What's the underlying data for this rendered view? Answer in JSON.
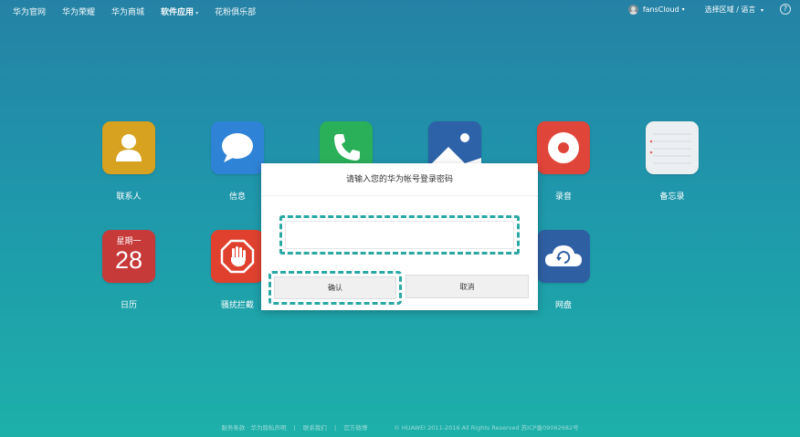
{
  "nav": {
    "items": [
      {
        "label": "华为官网"
      },
      {
        "label": "华为荣耀"
      },
      {
        "label": "华为商城"
      },
      {
        "label": "软件应用"
      },
      {
        "label": "花粉俱乐部"
      }
    ],
    "user": "fansCloud",
    "region": "选择区域 / 语言",
    "help": "?"
  },
  "apps": [
    {
      "label": "联系人",
      "color": "#d6a21f",
      "icon": "contact-icon"
    },
    {
      "label": "信息",
      "color": "#2f83d6",
      "icon": "message-icon"
    },
    {
      "label": "",
      "color": "#2bb05a",
      "icon": "phone-icon"
    },
    {
      "label": "",
      "color": "#2d62a8",
      "icon": "gallery-icon"
    },
    {
      "label": "录音",
      "color": "#e0453a",
      "icon": "record-icon"
    },
    {
      "label": "备忘录",
      "color": "#eceff2",
      "icon": "notepad-icon"
    },
    {
      "label": "日历",
      "color": "#c63a3a",
      "icon": "calendar-icon",
      "weekday": "星期一",
      "day": "28"
    },
    {
      "label": "骚扰拦截",
      "color": "#e0412f",
      "icon": "block-hand-icon"
    },
    {
      "label": "网盘",
      "color": "#2f5fa3",
      "icon": "cloud-icon"
    }
  ],
  "modal": {
    "title": "请输入您的华为帐号登录密码",
    "password_value": "",
    "confirm_label": "确认",
    "cancel_label": "取消"
  },
  "footer": {
    "links": [
      "服务条款 · 华为隐私声明",
      "|",
      "联系我们",
      "|",
      "官方微博"
    ],
    "copyright": "© HUAWEI 2011-2016 All Rights Reserved  苏ICP备09062682号"
  }
}
